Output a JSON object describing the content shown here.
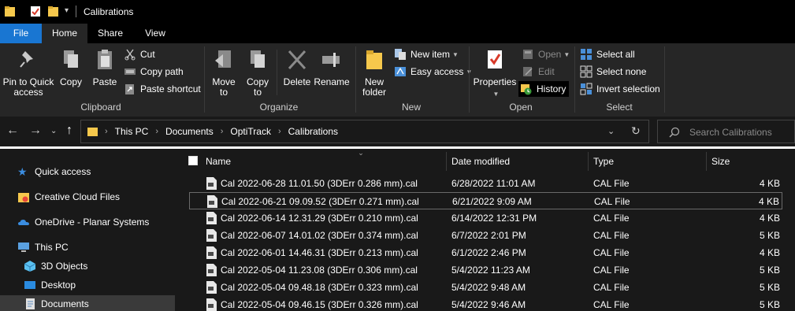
{
  "window": {
    "title": "Calibrations"
  },
  "tabs": [
    {
      "label": "File"
    },
    {
      "label": "Home"
    },
    {
      "label": "Share"
    },
    {
      "label": "View"
    }
  ],
  "ribbon": {
    "clipboard": {
      "label": "Clipboard",
      "pin": "Pin to Quick access",
      "copy": "Copy",
      "paste": "Paste",
      "cut": "Cut",
      "copy_path": "Copy path",
      "paste_shortcut": "Paste shortcut"
    },
    "organize": {
      "label": "Organize",
      "move_to": "Move to",
      "copy_to": "Copy to",
      "delete": "Delete",
      "rename": "Rename"
    },
    "new": {
      "label": "New",
      "new_folder": "New folder",
      "new_item": "New item",
      "easy_access": "Easy access"
    },
    "open": {
      "label": "Open",
      "properties": "Properties",
      "open": "Open",
      "edit": "Edit",
      "history": "History"
    },
    "select": {
      "label": "Select",
      "select_all": "Select all",
      "select_none": "Select none",
      "invert_selection": "Invert selection"
    }
  },
  "address": {
    "crumbs": [
      "This PC",
      "Documents",
      "OptiTrack",
      "Calibrations"
    ],
    "search_placeholder": "Search Calibrations"
  },
  "nav": {
    "items": [
      {
        "label": "Quick access"
      },
      {
        "label": "Creative Cloud Files"
      },
      {
        "label": "OneDrive - Planar Systems"
      },
      {
        "label": "This PC"
      },
      {
        "label": "3D Objects"
      },
      {
        "label": "Desktop"
      },
      {
        "label": "Documents"
      }
    ]
  },
  "files": {
    "columns": [
      "Name",
      "Date modified",
      "Type",
      "Size"
    ],
    "rows": [
      {
        "name": "Cal 2022-06-28 11.01.50 (3DErr 0.286 mm).cal",
        "date": "6/28/2022 11:01 AM",
        "type": "CAL File",
        "size": "4 KB"
      },
      {
        "name": "Cal 2022-06-21 09.09.52 (3DErr 0.271 mm).cal",
        "date": "6/21/2022 9:09 AM",
        "type": "CAL File",
        "size": "4 KB"
      },
      {
        "name": "Cal 2022-06-14 12.31.29 (3DErr 0.210 mm).cal",
        "date": "6/14/2022 12:31 PM",
        "type": "CAL File",
        "size": "4 KB"
      },
      {
        "name": "Cal 2022-06-07 14.01.02 (3DErr 0.374 mm).cal",
        "date": "6/7/2022 2:01 PM",
        "type": "CAL File",
        "size": "5 KB"
      },
      {
        "name": "Cal 2022-06-01 14.46.31 (3DErr 0.213 mm).cal",
        "date": "6/1/2022 2:46 PM",
        "type": "CAL File",
        "size": "4 KB"
      },
      {
        "name": "Cal 2022-05-04 11.23.08 (3DErr 0.306 mm).cal",
        "date": "5/4/2022 11:23 AM",
        "type": "CAL File",
        "size": "5 KB"
      },
      {
        "name": "Cal 2022-05-04 09.48.18 (3DErr 0.323 mm).cal",
        "date": "5/4/2022 9:48 AM",
        "type": "CAL File",
        "size": "5 KB"
      },
      {
        "name": "Cal 2022-05-04 09.46.15 (3DErr 0.326 mm).cal",
        "date": "5/4/2022 9:46 AM",
        "type": "CAL File",
        "size": "5 KB"
      }
    ]
  },
  "colors": {
    "accent": "#1976d2",
    "folder": "#f6c84c",
    "ribbon_bg": "#262626",
    "window_bg": "#191919"
  }
}
